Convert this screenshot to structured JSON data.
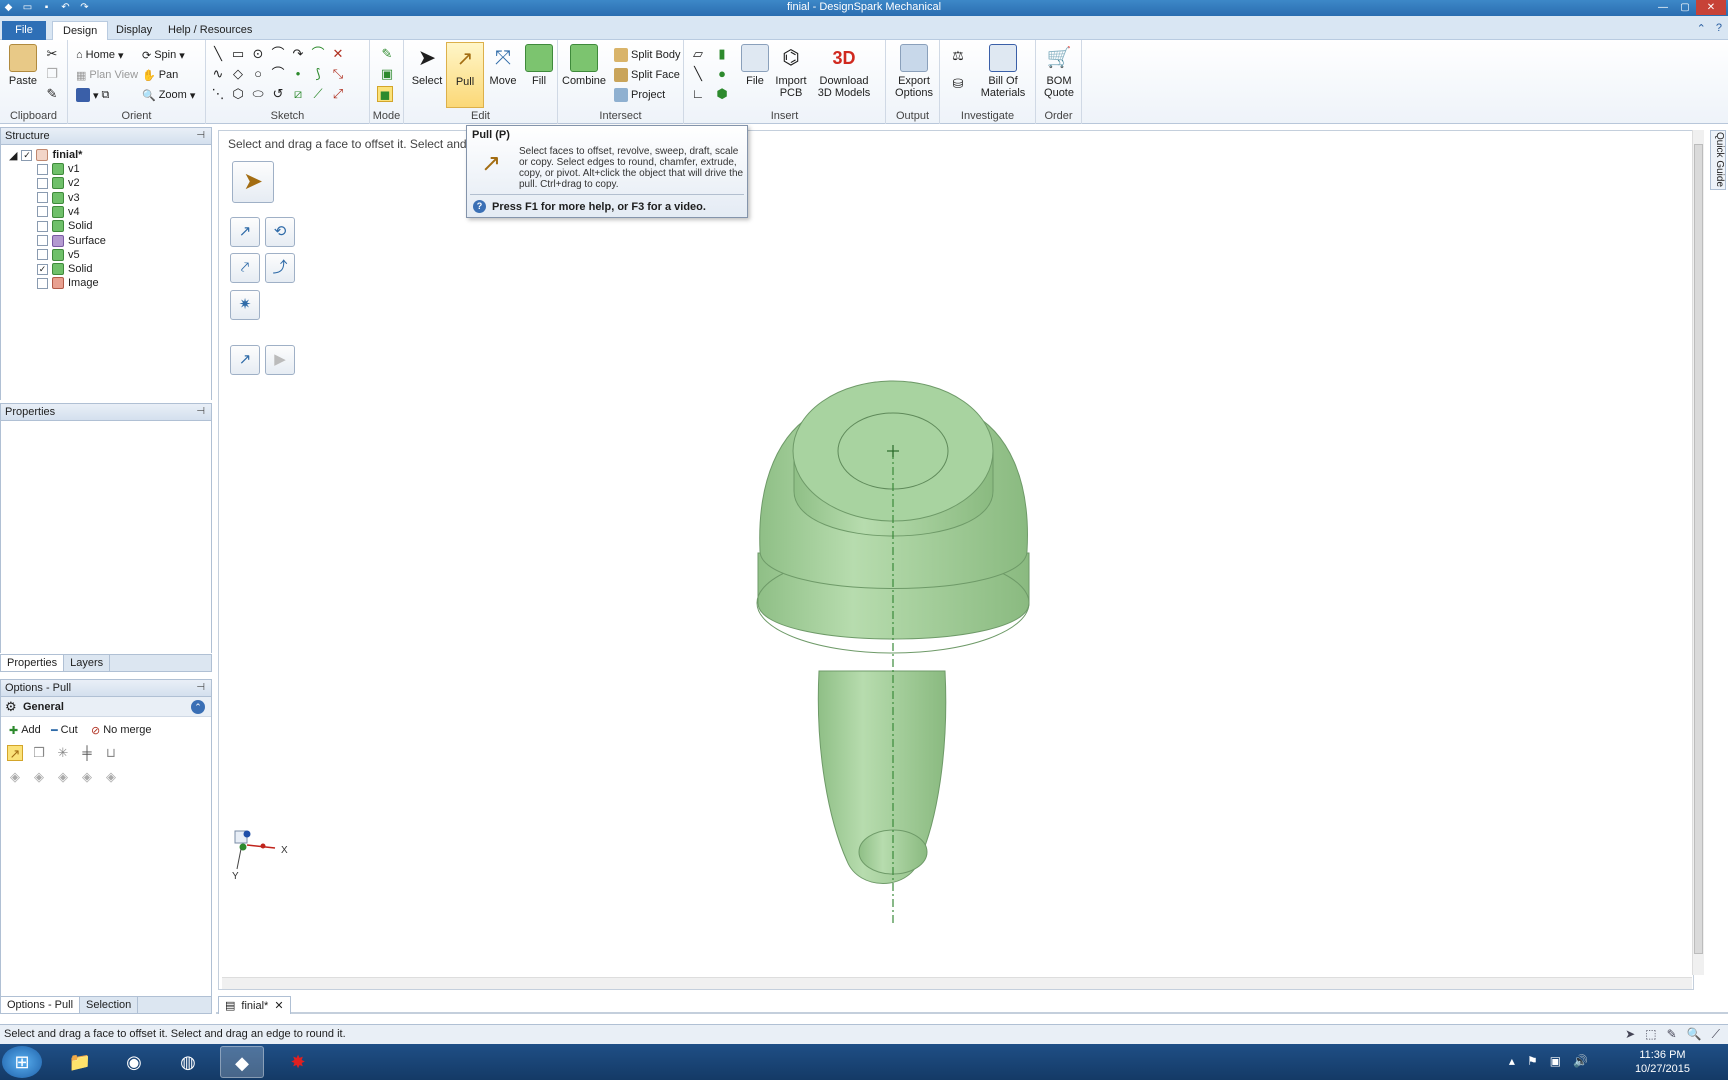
{
  "window": {
    "title": "finial - DesignSpark Mechanical"
  },
  "tabs": {
    "file": "File",
    "design": "Design",
    "display": "Display",
    "help": "Help / Resources"
  },
  "ribbon": {
    "clipboard": {
      "label": "Clipboard",
      "paste": "Paste"
    },
    "orient": {
      "label": "Orient",
      "home": "Home",
      "spin": "Spin",
      "plan_view": "Plan View",
      "pan": "Pan",
      "zoom": "Zoom"
    },
    "sketch": {
      "label": "Sketch"
    },
    "mode": {
      "label": "Mode"
    },
    "edit": {
      "label": "Edit",
      "select": "Select",
      "pull": "Pull",
      "move": "Move",
      "fill": "Fill"
    },
    "intersect": {
      "label": "Intersect",
      "combine": "Combine",
      "split_body": "Split Body",
      "split_face": "Split Face",
      "project": "Project"
    },
    "insert": {
      "label": "Insert",
      "file": "File",
      "import_pcb": "Import PCB",
      "download_3d": "Download 3D Models"
    },
    "output": {
      "label": "Output",
      "export": "Export Options"
    },
    "investigate": {
      "label": "Investigate",
      "bom": "Bill Of Materials"
    },
    "order": {
      "label": "Order",
      "bom_quote": "BOM Quote"
    }
  },
  "structure": {
    "title": "Structure",
    "root": "finial*",
    "items": [
      {
        "label": "v1",
        "checked": false,
        "kind": "solid"
      },
      {
        "label": "v2",
        "checked": false,
        "kind": "solid"
      },
      {
        "label": "v3",
        "checked": false,
        "kind": "solid"
      },
      {
        "label": "v4",
        "checked": false,
        "kind": "solid"
      },
      {
        "label": "Solid",
        "checked": false,
        "kind": "solid"
      },
      {
        "label": "Surface",
        "checked": false,
        "kind": "surface"
      },
      {
        "label": "v5",
        "checked": false,
        "kind": "solid"
      },
      {
        "label": "Solid",
        "checked": true,
        "kind": "solid"
      },
      {
        "label": "Image",
        "checked": false,
        "kind": "image"
      }
    ]
  },
  "properties": {
    "title": "Properties",
    "tab_properties": "Properties",
    "tab_layers": "Layers"
  },
  "options": {
    "title": "Options - Pull",
    "general": "General",
    "add": "Add",
    "cut": "Cut",
    "no_merge": "No merge",
    "tab_options": "Options - Pull",
    "tab_selection": "Selection"
  },
  "viewport": {
    "hint": "Select and drag a face to offset it. Select and"
  },
  "tooltip": {
    "title": "Pull (P)",
    "body": "Select faces to offset, revolve, sweep, draft, scale or copy. Select edges to round, chamfer, extrude, copy, or pivot. Alt+click the object that will drive the pull. Ctrl+drag to copy.",
    "footer": "Press F1 for more help, or F3 for a video."
  },
  "quick_guide": "Quick Guide",
  "doc_tab": "finial*",
  "status": "Select and drag a face to offset it. Select and drag an edge to round it.",
  "clock": {
    "time": "11:36 PM",
    "date": "10/27/2015"
  },
  "colors": {
    "model": "#a8d3a0",
    "model_dark": "#6e9a68",
    "accent": "#2e6fb6"
  }
}
